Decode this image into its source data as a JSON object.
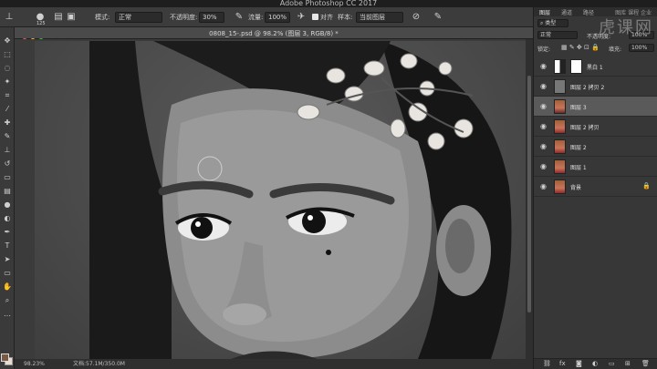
{
  "window": {
    "title": "Adobe Photoshop CC 2017"
  },
  "watermark": {
    "brand": "虎课网",
    "nav": "图库   课程   企业"
  },
  "options_bar": {
    "brush_size": "125",
    "mode_label": "模式:",
    "mode_value": "正常",
    "opacity_label": "不透明度:",
    "opacity_value": "30%",
    "flow_label": "流量:",
    "flow_value": "100%",
    "align_label": "对齐",
    "sample_label": "样本:",
    "sample_value": "当前图层"
  },
  "document": {
    "tab_title": "0808_15-.psd @ 98.2% (图层 3, RGB/8) *",
    "zoom": "98.23%",
    "doc_info": "文档:57.1M/350.0M"
  },
  "layers_panel": {
    "tabs": [
      "图层",
      "通道",
      "路径"
    ],
    "kind_label": "类型",
    "blend_mode": "正常",
    "opacity_label": "不透明度:",
    "opacity_value": "100%",
    "lock_label": "锁定:",
    "fill_label": "填充:",
    "fill_value": "100%",
    "layers": [
      {
        "name": "黑白 1",
        "visible": true,
        "selected": false,
        "kind": "adjustment"
      },
      {
        "name": "图层 2 拷贝 2",
        "visible": true,
        "selected": false,
        "kind": "gray"
      },
      {
        "name": "图层 3",
        "visible": true,
        "selected": true,
        "kind": "photo"
      },
      {
        "name": "图层 2 拷贝",
        "visible": true,
        "selected": false,
        "kind": "photo"
      },
      {
        "name": "图层 2",
        "visible": true,
        "selected": false,
        "kind": "photo"
      },
      {
        "name": "图层 1",
        "visible": true,
        "selected": false,
        "kind": "photo"
      },
      {
        "name": "背景",
        "visible": true,
        "selected": false,
        "kind": "photo",
        "locked": true
      }
    ],
    "bottom_buttons": [
      "link-icon",
      "fx-icon",
      "mask-icon",
      "adjustment-icon",
      "group-icon",
      "new-layer-icon",
      "trash-icon"
    ]
  },
  "colors": {
    "selected_layer": "#5a5a5a",
    "foreground": "#7a5a44",
    "background": "#e8ddd0"
  }
}
